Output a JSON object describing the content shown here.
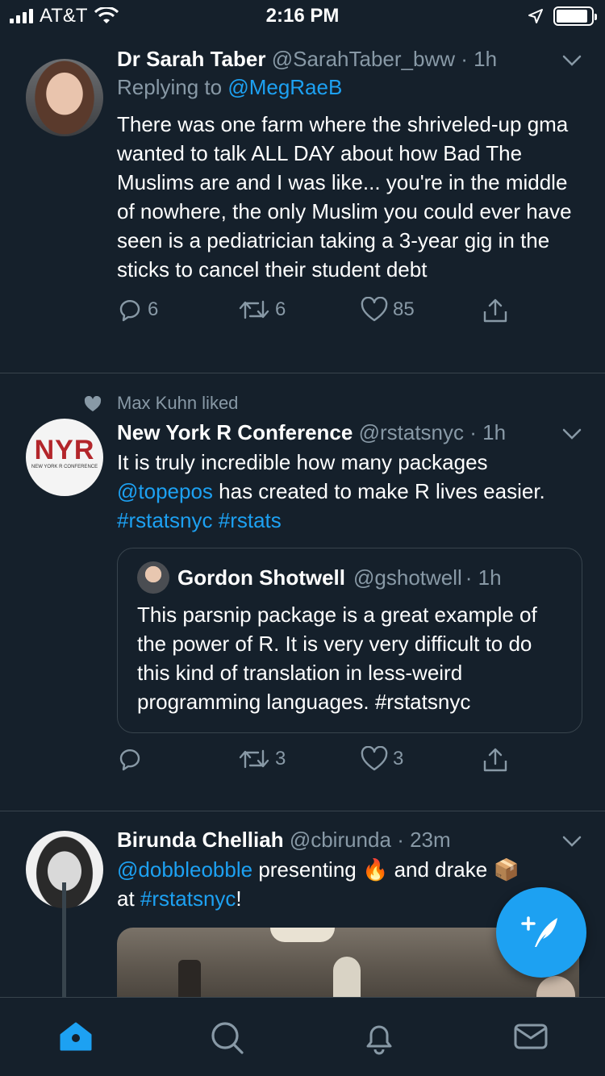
{
  "status_bar": {
    "carrier": "AT&T",
    "time": "2:16 PM"
  },
  "tweets": [
    {
      "name": "Dr Sarah Taber",
      "handle": "@SarahTaber_bww",
      "time": "· 1h",
      "replying_label": "Replying to",
      "replying_to": "@MegRaeB",
      "text": "There was one farm where the shriveled-up gma wanted to talk ALL DAY about how Bad The Muslims are and I was like... you're in the middle of nowhere, the only Muslim you could ever have seen is a pediatrician taking a 3-year gig in the sticks to cancel their student debt",
      "replies": "6",
      "retweets": "6",
      "likes": "85"
    },
    {
      "social_context": "Max Kuhn liked",
      "name": "New York R Conference",
      "handle": "@rstatsnyc",
      "time": "· 1h",
      "avatar_text": "NYR",
      "avatar_subtext": "NEW YORK R CONFERENCE",
      "text_1": "It is truly incredible how many packages",
      "mention": "@topepos",
      "text_2": " has created to make R lives easier. ",
      "hashtag_1": "#rstatsnyc",
      "hashtag_2": "#rstats",
      "quote": {
        "name": "Gordon Shotwell",
        "handle": "@gshotwell",
        "time": "· 1h",
        "text": "This parsnip package is a great example of the power of R. It is very very difficult to do this kind of translation in less-weird programming languages. #rstatsnyc"
      },
      "retweets": "3",
      "likes": "3"
    },
    {
      "name": "Birunda Chelliah",
      "handle": "@cbirunda",
      "time": "· 23m",
      "mention": "@dobbleobble",
      "text_1": " presenting ",
      "emoji_1": "🔥",
      "text_2": " and  drake ",
      "emoji_2": "📦",
      "text_3": "at ",
      "hashtag": "#rstatsnyc",
      "text_4": "!"
    }
  ],
  "icons": {
    "reply": "reply-icon",
    "retweet": "retweet-icon",
    "like": "heart-icon",
    "share": "share-icon",
    "compose": "compose-tweet-icon"
  },
  "tabs": [
    "home",
    "search",
    "notifications",
    "messages"
  ],
  "colors": {
    "background": "#15202b",
    "accent": "#1da1f2",
    "secondary_text": "#8899a6",
    "divider": "#38444d"
  }
}
